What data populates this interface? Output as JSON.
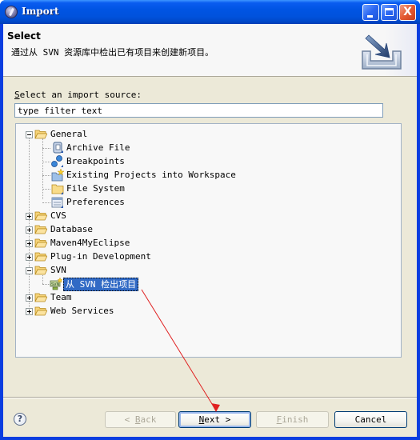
{
  "window": {
    "title": "Import",
    "controls": {
      "minimize": "_",
      "maximize": "□",
      "close": "X"
    }
  },
  "header": {
    "title": "Select",
    "description": "通过从 SVN 资源库中检出已有项目来创建新项目。",
    "image_icon": "import-wizard-icon"
  },
  "source": {
    "label_mnemonic": "S",
    "label_rest": "elect an import source:",
    "filter_value": "type filter text",
    "filter_placeholder": "type filter text"
  },
  "tree": {
    "nodes": [
      {
        "label": "General",
        "expanded": true,
        "icon": "folder-open-icon",
        "children": [
          {
            "label": "Archive File",
            "icon": "archive-file-icon"
          },
          {
            "label": "Breakpoints",
            "icon": "breakpoints-icon"
          },
          {
            "label": "Existing Projects into Workspace",
            "icon": "existing-projects-icon"
          },
          {
            "label": "File System",
            "icon": "file-system-icon"
          },
          {
            "label": "Preferences",
            "icon": "preferences-icon"
          }
        ]
      },
      {
        "label": "CVS",
        "expanded": false,
        "icon": "folder-icon"
      },
      {
        "label": "Database",
        "expanded": false,
        "icon": "folder-icon"
      },
      {
        "label": "Maven4MyEclipse",
        "expanded": false,
        "icon": "folder-icon"
      },
      {
        "label": "Plug-in Development",
        "expanded": false,
        "icon": "folder-icon"
      },
      {
        "label": "SVN",
        "expanded": true,
        "icon": "folder-open-icon",
        "children": [
          {
            "label": "从 SVN 检出项目",
            "icon": "svn-checkout-icon",
            "selected": true
          }
        ]
      },
      {
        "label": "Team",
        "expanded": false,
        "icon": "folder-icon"
      },
      {
        "label": "Web Services",
        "expanded": false,
        "icon": "folder-icon"
      }
    ]
  },
  "buttons": {
    "help": "?",
    "back": {
      "prefix": "< ",
      "mnemonic": "B",
      "rest": "ack",
      "enabled": false
    },
    "next": {
      "mnemonic": "N",
      "rest": "ext >",
      "enabled": true,
      "default": true
    },
    "finish": {
      "mnemonic": "F",
      "rest": "inish",
      "enabled": false
    },
    "cancel": {
      "label": "Cancel",
      "enabled": true
    }
  },
  "annotation": {
    "type": "arrow",
    "color": "#e02020",
    "from": "selected-tree-item",
    "to": "next-button"
  }
}
